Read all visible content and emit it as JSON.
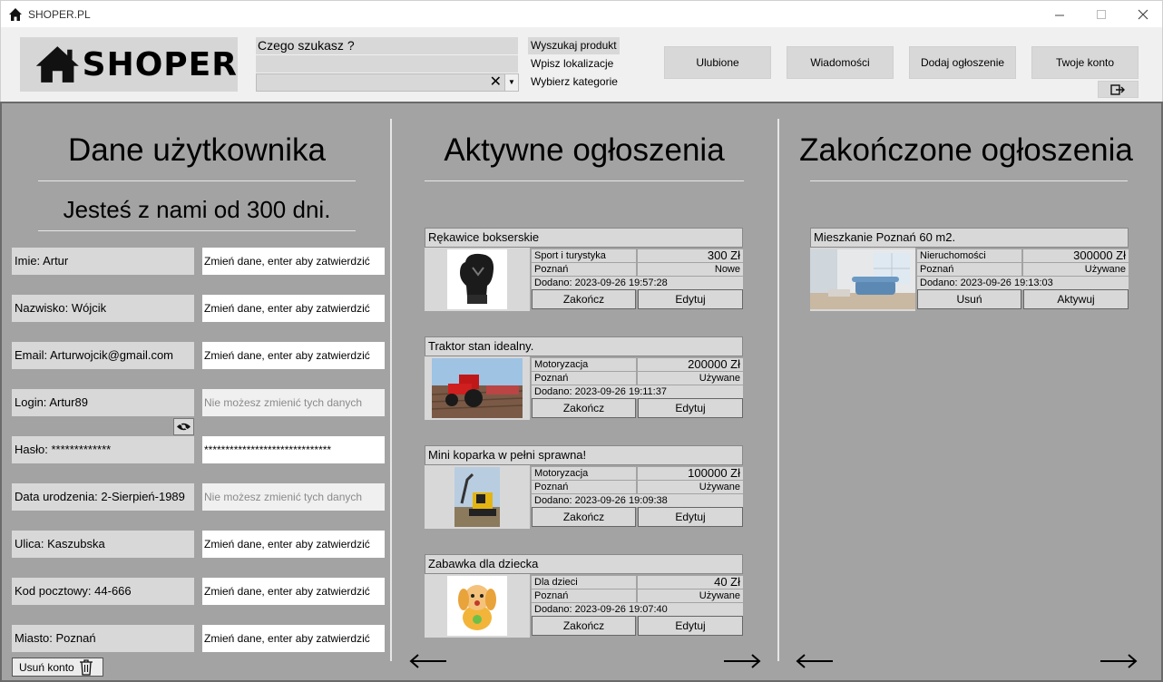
{
  "window": {
    "title": "SHOPER.PL"
  },
  "header": {
    "logo_text": "SHOPER",
    "search_query": "Czego szukasz ?",
    "search_buttons": [
      "Wyszukaj produkt",
      "Wpisz lokalizacje",
      "Wybierz kategorie"
    ],
    "clear_glyph": "✕",
    "nav": [
      "Ulubione",
      "Wiadomości",
      "Dodaj ogłoszenie",
      "Twoje konto"
    ]
  },
  "user_panel": {
    "title": "Dane użytkownika",
    "since": "Jesteś z nami od 300 dni.",
    "rows": [
      {
        "label": "Imie: Artur",
        "input": "Zmień dane, enter aby zatwierdzić",
        "editable": true
      },
      {
        "label": "Nazwisko: Wójcik",
        "input": "Zmień dane, enter aby zatwierdzić",
        "editable": true
      },
      {
        "label": "Email: Arturwojcik@gmail.com",
        "input": "Zmień dane, enter aby zatwierdzić",
        "editable": true
      },
      {
        "label": "Login: Artur89",
        "input": "Nie możesz zmienić tych danych",
        "editable": false
      },
      {
        "label": "Hasło: *************",
        "input": "******************************",
        "editable": true
      },
      {
        "label": "Data urodzenia: 2-Sierpień-1989",
        "input": "Nie możesz zmienić tych danych",
        "editable": false
      },
      {
        "label": "Ulica: Kaszubska",
        "input": "Zmień dane, enter aby zatwierdzić",
        "editable": true
      },
      {
        "label": "Kod pocztowy: 44-666",
        "input": "Zmień dane, enter aby zatwierdzić",
        "editable": true
      },
      {
        "label": "Miasto: Poznań",
        "input": "Zmień dane, enter aby zatwierdzić",
        "editable": true
      }
    ],
    "delete_account": "Usuń konto"
  },
  "active_panel": {
    "title": "Aktywne ogłoszenia",
    "listings": [
      {
        "title": "Rękawice bokserskie",
        "category": "Sport i turystyka",
        "price": "300 Zł",
        "location": "Poznań",
        "condition": "Nowe",
        "added": "Dodano: 2023-09-26 19:57:28",
        "btn1": "Zakończ",
        "btn2": "Edytuj",
        "image": "boxing-glove"
      },
      {
        "title": "Traktor stan idealny.",
        "category": "Motoryzacja",
        "price": "200000 Zł",
        "location": "Poznań",
        "condition": "Używane",
        "added": "Dodano: 2023-09-26 19:11:37",
        "btn1": "Zakończ",
        "btn2": "Edytuj",
        "image": "tractor"
      },
      {
        "title": "Mini koparka w pełni sprawna!",
        "category": "Motoryzacja",
        "price": "100000 Zł",
        "location": "Poznań",
        "condition": "Używane",
        "added": "Dodano: 2023-09-26 19:09:38",
        "btn1": "Zakończ",
        "btn2": "Edytuj",
        "image": "excavator"
      },
      {
        "title": "Zabawka dla dziecka",
        "category": "Dla dzieci",
        "price": "40 Zł",
        "location": "Poznań",
        "condition": "Używane",
        "added": "Dodano: 2023-09-26 19:07:40",
        "btn1": "Zakończ",
        "btn2": "Edytuj",
        "image": "toy-dog"
      }
    ]
  },
  "ended_panel": {
    "title": "Zakończone ogłoszenia",
    "listings": [
      {
        "title": "Mieszkanie Poznań 60 m2.",
        "category": "Nieruchomości",
        "price": "300000 Zł",
        "location": "Poznań",
        "condition": "Używane",
        "added": "Dodano: 2023-09-26 19:13:03",
        "btn1": "Usuń",
        "btn2": "Aktywuj",
        "image": "living-room"
      }
    ]
  },
  "colors": {
    "panel_bg": "#a3a3a3",
    "widget_bg": "#d8d8d8",
    "header_bg": "#f0f0f0"
  }
}
